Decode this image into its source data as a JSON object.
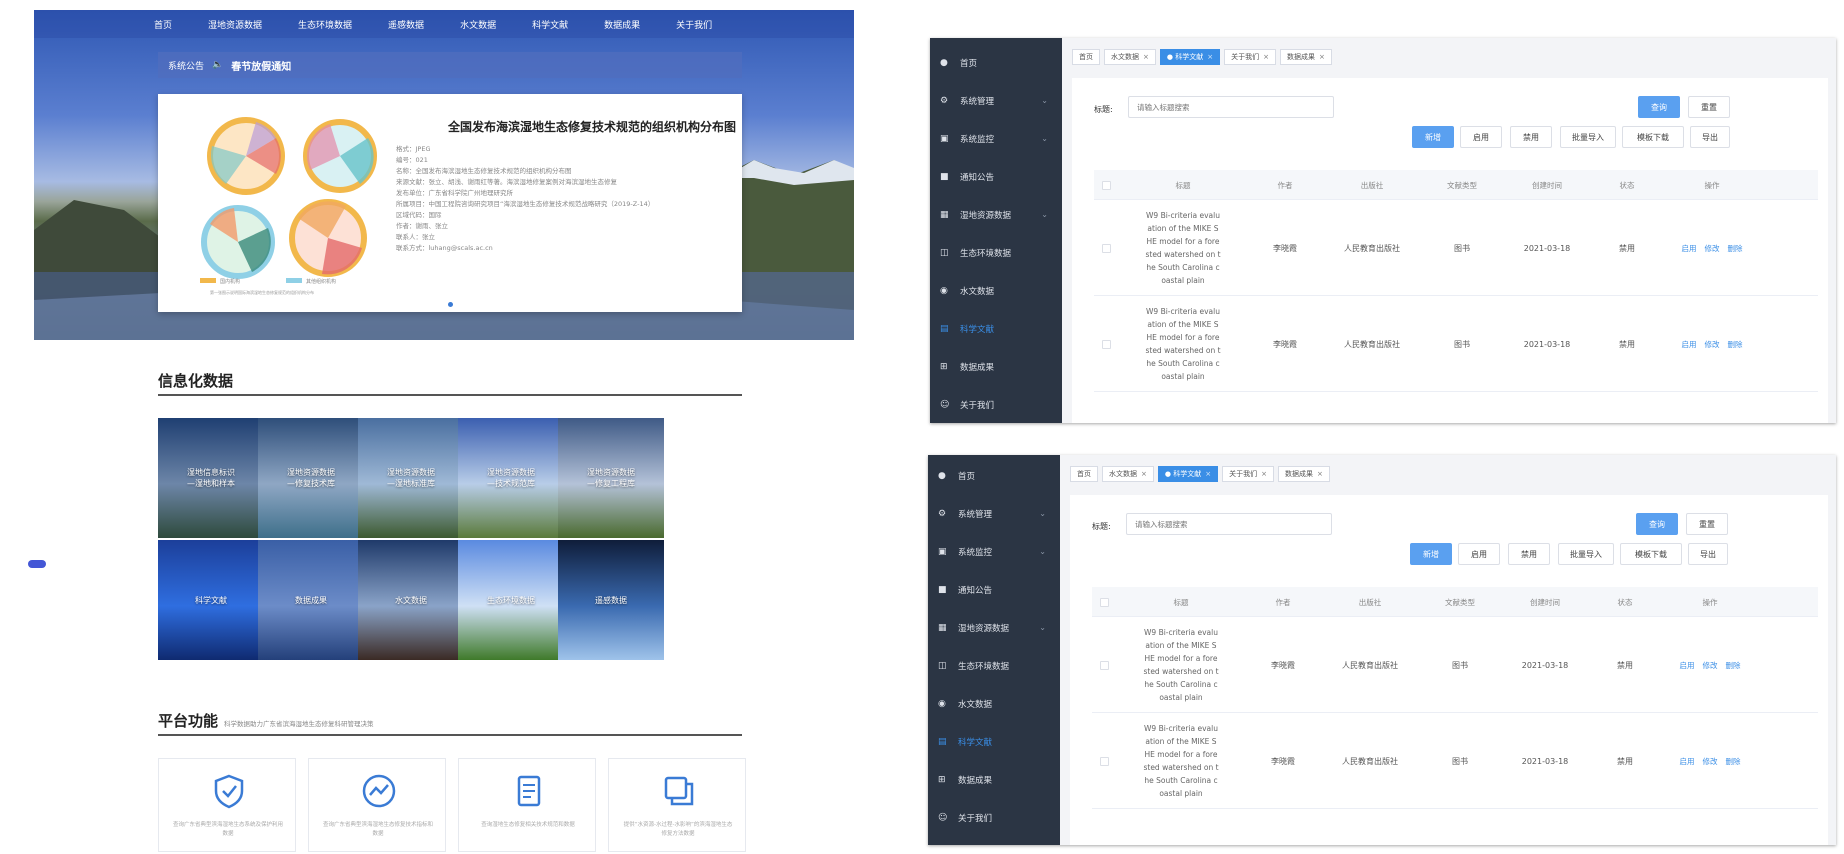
{
  "portal": {
    "nav": [
      "首页",
      "湿地资源数据",
      "生态环境数据",
      "遥感数据",
      "水文数据",
      "科学文献",
      "数据成果",
      "关于我们"
    ],
    "notice": {
      "label": "系统公告",
      "title": "春节放假通知"
    },
    "featured": {
      "title": "全国发布海滨湿地生态修复技术规范的组织机构分布图",
      "meta": [
        "格式：JPEG",
        "编号：021",
        "名称：全国发布海滨湿地生态修复技术规范的组织机构分布图",
        "来源文献：张立、胡浅、谢雨红等著。海滨湿地修复案例对海滨湿地生态修复",
        "发布单位：广东省科学院广州地理研究所",
        "所属项目：中国工程院咨询研究项目“海滨湿地生态修复技术规范战略研究（2019-Z-14）",
        "区域代码：国际",
        "作者：谢雨、张立",
        "联系人：张立",
        "联系方式：luhang@scals.ac.cn"
      ],
      "legend": [
        "国内机构",
        "其他组织机构",
        "第一张图示说明国际海滨湿地生态修复规范的组织机构分布"
      ]
    },
    "info_section": {
      "title": "信息化数据"
    },
    "tiles": [
      {
        "label": "湿地信息标识\n—湿地和样本",
        "colors": [
          "#1f3f72",
          "#6d86a8",
          "#2e4a3c"
        ]
      },
      {
        "label": "湿地资源数据\n—修复技术库",
        "colors": [
          "#2e4e7a",
          "#8fa7c4",
          "#3e6f8a"
        ]
      },
      {
        "label": "湿地资源数据\n—湿地标准库",
        "colors": [
          "#4a6fa0",
          "#9fb9d6",
          "#3d5a2f"
        ]
      },
      {
        "label": "湿地资源数据\n—技术规范库",
        "colors": [
          "#3b5fb0",
          "#b8cde8",
          "#5a7a3a"
        ]
      },
      {
        "label": "湿地资源数据\n—修复工程库",
        "colors": [
          "#3f5a86",
          "#b4c2d8",
          "#4a6a2e"
        ]
      },
      {
        "label": "科学文献",
        "colors": [
          "#1c3f9a",
          "#2f6ee0",
          "#0f2a70"
        ]
      },
      {
        "label": "数据成果",
        "colors": [
          "#3a5fa6",
          "#6c8cc8",
          "#24407a"
        ]
      },
      {
        "label": "水文数据",
        "colors": [
          "#1f3a6a",
          "#8aa3c8",
          "#3b2a24"
        ]
      },
      {
        "label": "生态环境数据",
        "colors": [
          "#5a8ae0",
          "#cfe0f5",
          "#3f7a2a"
        ]
      },
      {
        "label": "遥感数据",
        "colors": [
          "#0f1d3a",
          "#3a6ab0",
          "#9fc3ea"
        ]
      }
    ],
    "function_section": {
      "title": "平台功能",
      "subtitle": "科学数据助力广东省滨海湿地生态修复科研管理决策"
    },
    "functions": [
      {
        "icon": "shield-check-icon",
        "text": "查询广东省典型滨海湿地生态系统及保护利用数据"
      },
      {
        "icon": "trend-chart-icon",
        "text": "查询广东省典型滨海湿地生态修复技术指标和数据"
      },
      {
        "icon": "document-icon",
        "text": "查询湿地生态修复相关技术规范和数据"
      },
      {
        "icon": "copy-window-icon",
        "text": "提供“水资源-水过程-水影响”的滨海湿地生态修复方法数据"
      }
    ]
  },
  "admin": {
    "menu": [
      {
        "label": "首页",
        "icon": "dashboard-icon",
        "chevron": false
      },
      {
        "label": "系统管理",
        "icon": "gear-icon",
        "chevron": true
      },
      {
        "label": "系统监控",
        "icon": "monitor-icon",
        "chevron": true
      },
      {
        "label": "通知公告",
        "icon": "message-icon",
        "chevron": false
      },
      {
        "label": "湿地资源数据",
        "icon": "folder-icon",
        "chevron": true
      },
      {
        "label": "生态环境数据",
        "icon": "book-icon",
        "chevron": false
      },
      {
        "label": "水文数据",
        "icon": "drop-icon",
        "chevron": false
      },
      {
        "label": "科学文献",
        "icon": "document-icon",
        "chevron": false,
        "active": true
      },
      {
        "label": "数据成果",
        "icon": "grid-icon",
        "chevron": false
      },
      {
        "label": "关于我们",
        "icon": "user-icon",
        "chevron": false
      }
    ],
    "tabs": [
      {
        "label": "首页",
        "closable": false
      },
      {
        "label": "水文数据",
        "closable": true
      },
      {
        "label": "● 科学文献",
        "closable": true,
        "active": true
      },
      {
        "label": "关于我们",
        "closable": true
      },
      {
        "label": "数据成果",
        "closable": true
      }
    ],
    "close_glyph": "×",
    "search": {
      "label": "标题:",
      "placeholder": "请输入标题搜索"
    },
    "buttons": {
      "query": "查询",
      "reset": "重置",
      "add": "新增",
      "enable": "启用",
      "disable": "禁用",
      "import": "批量导入",
      "template": "模板下载",
      "export": "导出"
    },
    "columns": [
      "标题",
      "作者",
      "出版社",
      "文献类型",
      "创建时间",
      "状态",
      "操作"
    ],
    "rows": [
      {
        "title": "W9 Bi-criteria evalu\nation of the MIKE S\nHE model for a fore\nsted watershed on t\nhe South Carolina c\noastal plain",
        "author": "李晓霞",
        "publisher": "人民教育出版社",
        "type": "图书",
        "created": "2021-03-18",
        "status": "禁用"
      },
      {
        "title": "W9 Bi-criteria evalu\nation of the MIKE S\nHE model for a fore\nsted watershed on t\nhe South Carolina c\noastal plain",
        "author": "李晓霞",
        "publisher": "人民教育出版社",
        "type": "图书",
        "created": "2021-03-18",
        "status": "禁用"
      }
    ],
    "row_actions": [
      "启用",
      "修改",
      "删除"
    ]
  }
}
